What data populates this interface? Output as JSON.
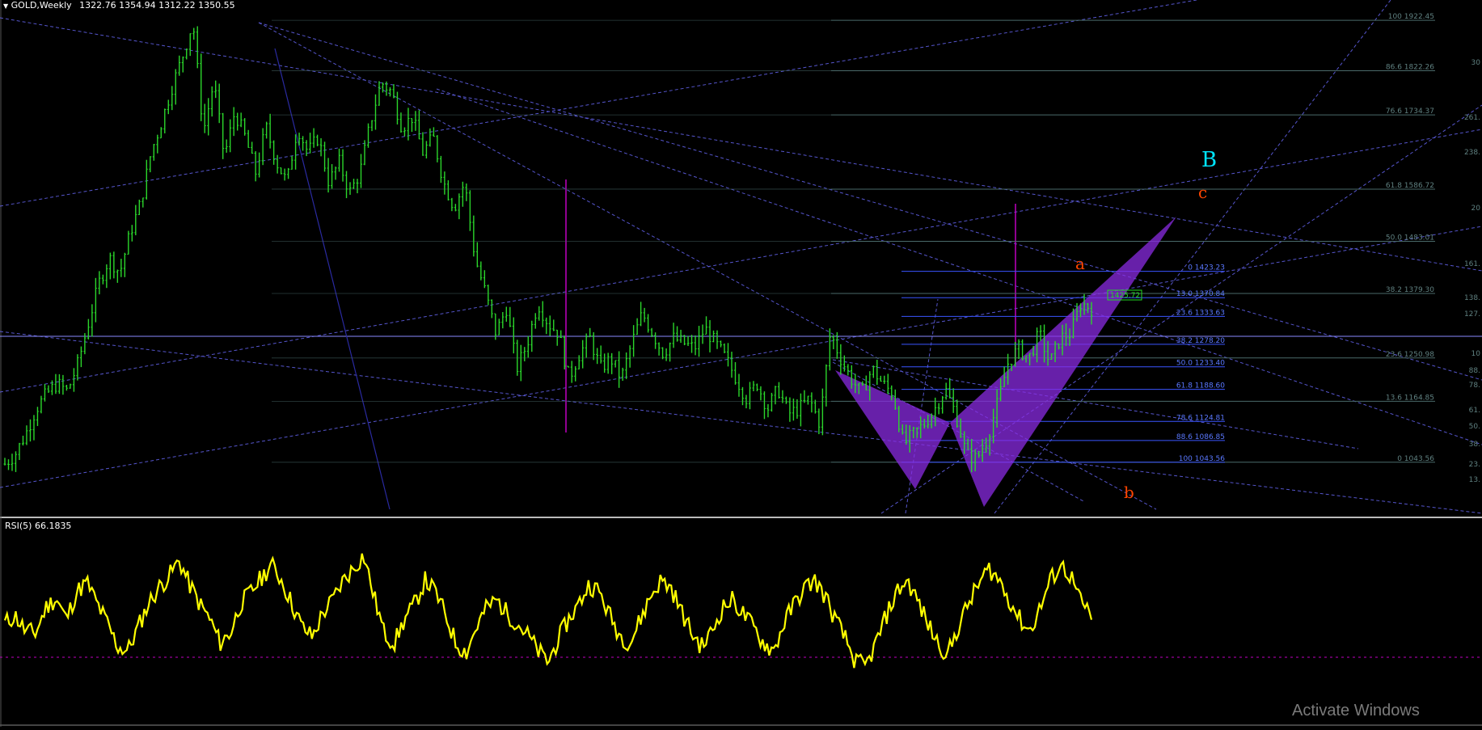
{
  "header": {
    "symbol": "GOLD,Weekly",
    "ohlc": "1322.76 1354.94 1312.22 1350.55"
  },
  "rsi": {
    "label": "RSI(5) 66.1835"
  },
  "watermark": "Activate Windows",
  "colors": {
    "background": "#000000",
    "candle": "#2bd62b",
    "rsi_line": "#ffff00",
    "pattern_fill": "#8a2be2",
    "trendline": "#6b6bff",
    "fib_grey": "#4a6a6a",
    "fib_blue": "#3a55ff",
    "label_orange": "#ff4500",
    "label_cyan": "#00e5ff",
    "magenta": "#c000c0"
  },
  "chart_data": {
    "type": "candlestick",
    "main": {
      "ylim": [
        950,
        1950
      ],
      "price_path": [
        1040,
        1060,
        1100,
        1150,
        1180,
        1200,
        1185,
        1240,
        1320,
        1400,
        1450,
        1420,
        1500,
        1560,
        1660,
        1720,
        1790,
        1850,
        1920,
        1700,
        1800,
        1650,
        1740,
        1690,
        1620,
        1710,
        1640,
        1600,
        1710,
        1660,
        1690,
        1600,
        1640,
        1580,
        1620,
        1720,
        1800,
        1780,
        1710,
        1730,
        1660,
        1690,
        1600,
        1550,
        1600,
        1450,
        1380,
        1300,
        1350,
        1230,
        1280,
        1360,
        1320,
        1300,
        1210,
        1260,
        1290,
        1230,
        1250,
        1210,
        1280,
        1340,
        1300,
        1260,
        1290,
        1280,
        1270,
        1310,
        1280,
        1250,
        1210,
        1170,
        1200,
        1150,
        1190,
        1140,
        1150,
        1170,
        1120,
        1300,
        1250,
        1210,
        1180,
        1230,
        1200,
        1180,
        1080,
        1100,
        1120,
        1150,
        1190,
        1140,
        1060,
        1050,
        1090,
        1160,
        1240,
        1270,
        1250,
        1300,
        1240,
        1290,
        1300,
        1360,
        1350
      ],
      "fib_right": [
        {
          "level": "100",
          "price": "1922.45"
        },
        {
          "level": "86.6",
          "price": "1822.26"
        },
        {
          "level": "76.6",
          "price": "1734.37"
        },
        {
          "level": "61.8",
          "price": "1586.72"
        },
        {
          "level": "50.0",
          "price": "1483.01"
        },
        {
          "level": "38.2",
          "price": "1379.30"
        },
        {
          "level": "23.6",
          "price": "1250.98"
        },
        {
          "level": "13.6",
          "price": "1164.85"
        },
        {
          "level": "0",
          "price": "1043.56"
        }
      ],
      "fib_mid": [
        {
          "level": "0",
          "price": "1423.23"
        },
        {
          "level": "13.0",
          "price": "1370.84"
        },
        {
          "level": "23.6",
          "price": "1333.63"
        },
        {
          "level": "38.2",
          "price": "1278.20"
        },
        {
          "level": "50.0",
          "price": "1233.40"
        },
        {
          "level": "61.8",
          "price": "1188.60"
        },
        {
          "level": "78.6",
          "price": "1124.81"
        },
        {
          "level": "88.6",
          "price": "1086.85"
        },
        {
          "level": "100",
          "price": "1043.56"
        }
      ],
      "fib_edge": [
        "30",
        "261.",
        "238.",
        "20",
        "161.",
        "138.",
        "127.",
        "10",
        "88.",
        "78.",
        "61.",
        "50.",
        "38.",
        "23.",
        "13."
      ],
      "price_tag": "1425.72",
      "wave_labels": [
        "B",
        "c",
        "a",
        "b"
      ]
    },
    "rsi": {
      "ylim": [
        0,
        100
      ],
      "values": [
        50,
        54,
        46,
        45,
        58,
        63,
        52,
        66,
        71,
        60,
        50,
        38,
        36,
        48,
        60,
        68,
        74,
        82,
        70,
        60,
        52,
        40,
        45,
        60,
        66,
        73,
        80,
        72,
        60,
        48,
        43,
        55,
        62,
        72,
        78,
        85,
        64,
        45,
        40,
        52,
        60,
        72,
        66,
        54,
        40,
        35,
        48,
        58,
        62,
        55,
        50,
        44,
        36,
        30,
        42,
        52,
        60,
        70,
        66,
        54,
        44,
        40,
        52,
        64,
        72,
        68,
        56,
        45,
        38,
        46,
        58,
        62,
        55,
        48,
        40,
        36,
        50,
        60,
        68,
        72,
        64,
        52,
        42,
        30,
        28,
        40,
        54,
        66,
        72,
        62,
        50,
        40,
        34,
        48,
        60,
        70,
        78,
        72,
        62,
        52,
        46,
        58,
        72,
        80,
        74,
        60,
        54
      ]
    }
  }
}
